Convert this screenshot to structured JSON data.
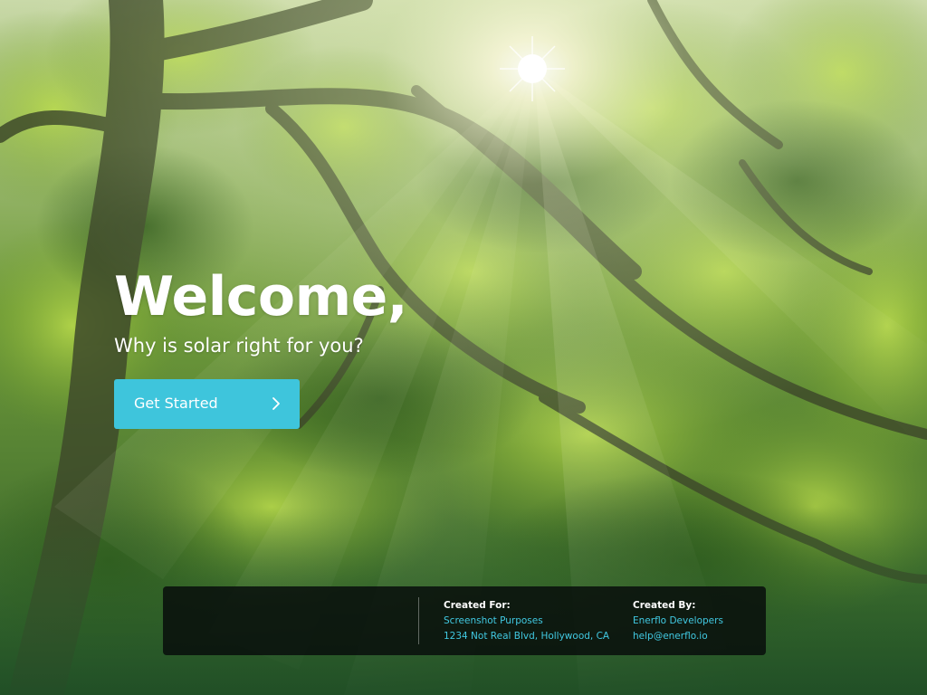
{
  "hero": {
    "title": "Welcome,",
    "subtitle": "Why is solar right for you?"
  },
  "cta": {
    "label": "Get Started",
    "icon": "chevron-right-icon"
  },
  "footer": {
    "created_for": {
      "heading": "Created For:",
      "lines": [
        "Screenshot Purposes",
        "1234 Not Real Blvd, Hollywood, CA"
      ]
    },
    "created_by": {
      "heading": "Created By:",
      "lines": [
        "Enerflo Developers",
        "help@enerflo.io"
      ]
    }
  },
  "colors": {
    "accent": "#3ec5dc",
    "link_text": "#41c9e2",
    "footer_bg": "#080e0c",
    "heading_text": "#ffffff"
  }
}
